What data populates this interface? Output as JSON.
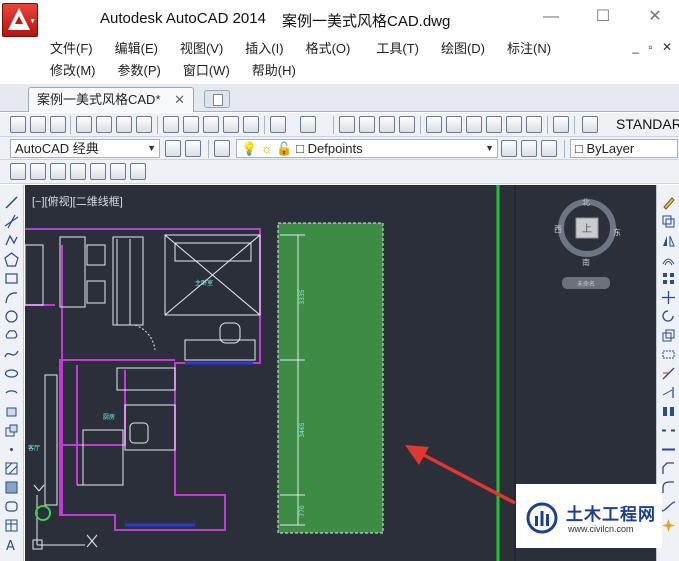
{
  "window": {
    "app_title": "Autodesk AutoCAD 2014",
    "file_title": "案例一美式风格CAD.dwg",
    "minimize": "—",
    "maximize": "☐",
    "close": "✕"
  },
  "menu": {
    "row1": [
      "文件(F)",
      "编辑(E)",
      "视图(V)",
      "插入(I)",
      "格式(O)",
      "工具(T)",
      "绘图(D)",
      "标注(N)"
    ],
    "row2": [
      "修改(M)",
      "参数(P)",
      "窗口(W)",
      "帮助(H)"
    ],
    "mdi_controls": "_ ▫ ✕"
  },
  "tabs": {
    "active_label": "案例一美式风格CAD*",
    "close_glyph": "✕"
  },
  "toolbar": {
    "workspace": "AutoCAD 经典",
    "layer": "Defpoints",
    "color": "ByLayer",
    "text_style": "STANDARD"
  },
  "canvas": {
    "view_label": "[−][俯视][二维线框]",
    "background": "#2a2f3a",
    "dimension_labels": [
      "3335",
      "3465",
      "770"
    ],
    "room_labels": [
      "主卧室",
      "厨房",
      "客厅"
    ],
    "selection_color": "#3d8b45",
    "accent_magenta": "#c23bd4",
    "accent_green_line": "#22c42d",
    "arrow_color": "#e0372f"
  },
  "viewcube": {
    "north": "北",
    "south": "南",
    "west": "西",
    "east": "东",
    "top_face": "上",
    "wcs": "未命名"
  },
  "watermark": {
    "name": "土木工程网",
    "url": "www.civilcn.com"
  }
}
